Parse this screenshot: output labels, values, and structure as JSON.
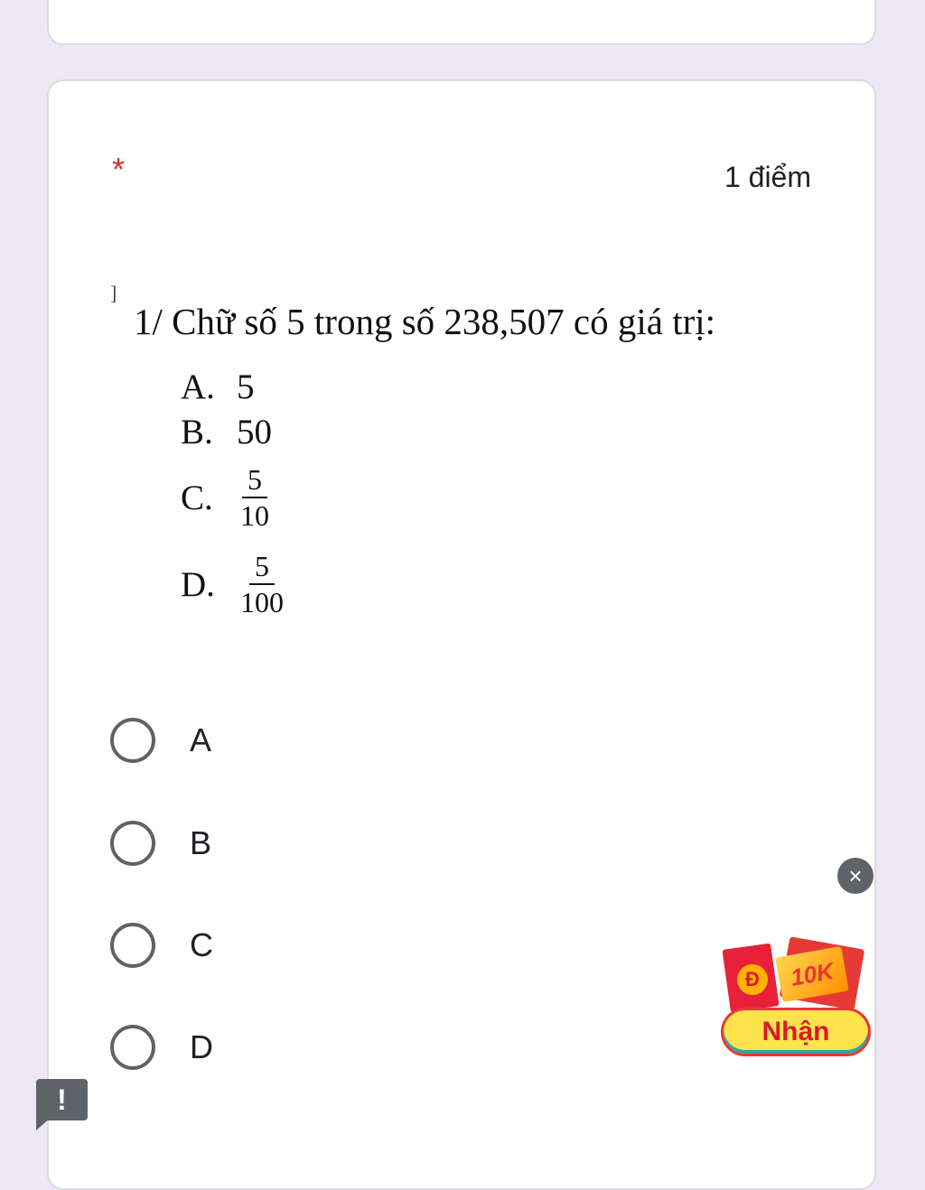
{
  "question": {
    "required_mark": "*",
    "points": "1 điểm",
    "image": {
      "corner_mark": "]",
      "text": "1/ Chữ số 5 trong số 238,507 có giá trị:",
      "options": [
        {
          "letter": "A.",
          "value": "5"
        },
        {
          "letter": "B.",
          "value": "50"
        },
        {
          "letter": "C.",
          "numerator": "5",
          "denominator": "10"
        },
        {
          "letter": "D.",
          "numerator": "5",
          "denominator": "100"
        }
      ]
    },
    "choices": [
      "A",
      "B",
      "C",
      "D"
    ]
  },
  "promo": {
    "close_icon": "×",
    "coin_symbol": "Đ",
    "amount": "10K",
    "button_label": "Nhận"
  },
  "feedback": {
    "icon": "!"
  },
  "colors": {
    "background": "#ede7f6",
    "required": "#d93025",
    "radio": "#5f6368",
    "promo_button": "#ffe34d",
    "promo_red": "#e53935"
  }
}
